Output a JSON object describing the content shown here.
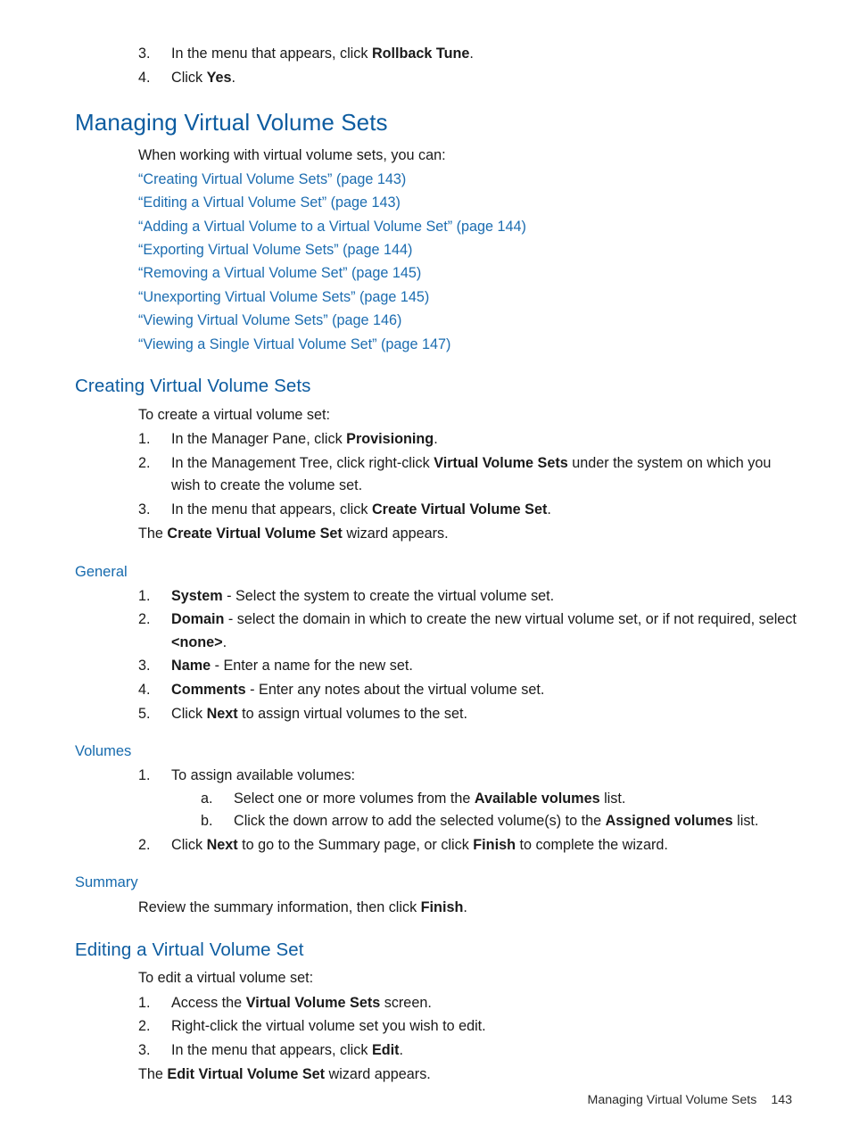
{
  "document": {
    "footer_title": "Managing Virtual Volume Sets",
    "footer_page": "143",
    "accent_heading_color": "#0d5ca0",
    "link_color": "#1b6cb0",
    "body_color": "#1a1a1a"
  },
  "top_steps": {
    "items": [
      {
        "marker": "3.",
        "pre": "In the menu that appears, click ",
        "bold": "Rollback Tune",
        "post": "."
      },
      {
        "marker": "4.",
        "pre": "Click ",
        "bold": "Yes",
        "post": "."
      }
    ]
  },
  "managing": {
    "heading": "Managing Virtual Volume Sets",
    "intro": "When working with virtual volume sets, you can:",
    "links": [
      "“Creating Virtual Volume Sets” (page 143)",
      "“Editing a Virtual Volume Set” (page 143)",
      "“Adding a Virtual Volume to a Virtual Volume Set” (page 144)",
      "“Exporting Virtual Volume Sets” (page 144)",
      "“Removing a Virtual Volume Set” (page 145)",
      "“Unexporting Virtual Volume Sets” (page 145)",
      "“Viewing Virtual Volume Sets” (page 146)",
      "“Viewing a Single Virtual Volume Set” (page 147)"
    ]
  },
  "creating": {
    "heading": "Creating Virtual Volume Sets",
    "intro": "To create a virtual volume set:",
    "steps": [
      {
        "marker": "1.",
        "pre": "In the Manager Pane, click ",
        "bold": "Provisioning",
        "post": "."
      },
      {
        "marker": "2.",
        "pre": "In the Management Tree, click right-click ",
        "bold": "Virtual Volume Sets",
        "post": " under the system on which you wish to create the volume set."
      },
      {
        "marker": "3.",
        "pre": "In the menu that appears, click ",
        "bold": "Create Virtual Volume Set",
        "post": "."
      }
    ],
    "closing": {
      "pre": "The ",
      "bold": "Create Virtual Volume Set",
      "post": " wizard appears."
    }
  },
  "general": {
    "heading": "General",
    "steps": [
      {
        "marker": "1.",
        "pre": "",
        "bold": "System",
        "post": " - Select the system to create the virtual volume set."
      },
      {
        "marker": "2.",
        "pre": "",
        "bold": "Domain",
        "post": " - select the domain in which to create the new virtual volume set, or if not required, select ",
        "bold2": "<none>",
        "post2": "."
      },
      {
        "marker": "3.",
        "pre": "",
        "bold": "Name",
        "post": " - Enter a name for the new set."
      },
      {
        "marker": "4.",
        "pre": "",
        "bold": "Comments",
        "post": " - Enter any notes about the virtual volume set."
      },
      {
        "marker": "5.",
        "pre": "Click ",
        "bold": "Next",
        "post": " to assign virtual volumes to the set."
      }
    ]
  },
  "volumes": {
    "heading": "Volumes",
    "step1": {
      "marker": "1.",
      "text": "To assign available volumes:"
    },
    "substeps": [
      {
        "marker": "a.",
        "pre": "Select one or more volumes from the ",
        "bold": "Available volumes",
        "post": " list."
      },
      {
        "marker": "b.",
        "pre": "Click the down arrow to add the selected volume(s) to the ",
        "bold": "Assigned volumes",
        "post": " list."
      }
    ],
    "step2": {
      "marker": "2.",
      "pre": "Click ",
      "bold": "Next",
      "mid": " to go to the Summary page, or click ",
      "bold2": "Finish",
      "post": " to complete the wizard."
    }
  },
  "summary": {
    "heading": "Summary",
    "pre": "Review the summary information, then click ",
    "bold": "Finish",
    "post": "."
  },
  "editing": {
    "heading": "Editing a Virtual Volume Set",
    "intro": "To edit a virtual volume set:",
    "steps": [
      {
        "marker": "1.",
        "pre": "Access the ",
        "bold": "Virtual Volume Sets",
        "post": " screen."
      },
      {
        "marker": "2.",
        "pre": "Right-click the virtual volume set you wish to edit.",
        "bold": "",
        "post": ""
      },
      {
        "marker": "3.",
        "pre": "In the menu that appears, click ",
        "bold": "Edit",
        "post": "."
      }
    ],
    "closing": {
      "pre": "The ",
      "bold": "Edit Virtual Volume Set",
      "post": " wizard appears."
    }
  }
}
